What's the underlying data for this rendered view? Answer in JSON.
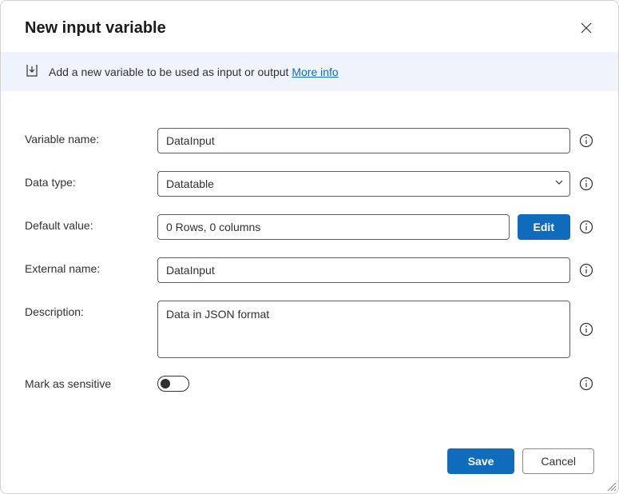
{
  "dialog": {
    "title": "New input variable",
    "banner": {
      "text": "Add a new variable to be used as input or output ",
      "link": "More info"
    }
  },
  "fields": {
    "name": {
      "label": "Variable name:",
      "value": "DataInput"
    },
    "dataType": {
      "label": "Data type:",
      "value": "Datatable"
    },
    "defaultValue": {
      "label": "Default value:",
      "value": "0 Rows, 0 columns",
      "editLabel": "Edit"
    },
    "externalName": {
      "label": "External name:",
      "value": "DataInput"
    },
    "description": {
      "label": "Description:",
      "value": "Data in JSON format"
    },
    "sensitive": {
      "label": "Mark as sensitive",
      "on": false
    }
  },
  "footer": {
    "save": "Save",
    "cancel": "Cancel"
  }
}
